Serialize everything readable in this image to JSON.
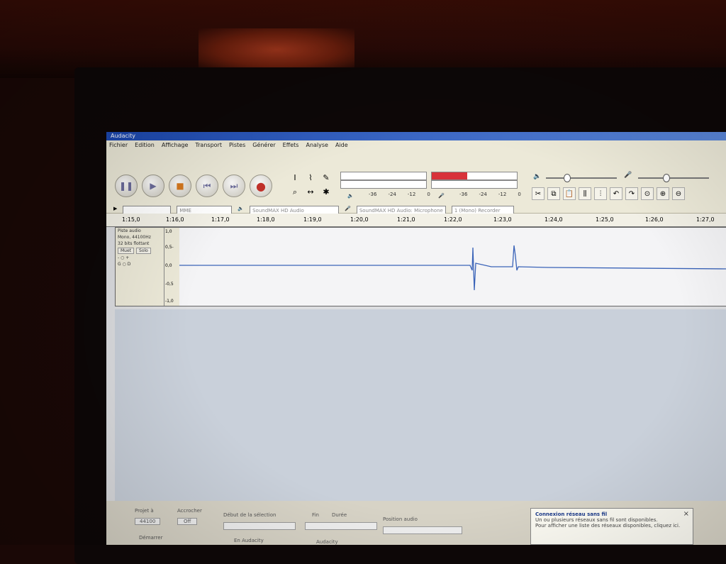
{
  "window": {
    "title": "Audacity"
  },
  "menu": [
    "Fichier",
    "Edition",
    "Affichage",
    "Transport",
    "Pistes",
    "Générer",
    "Effets",
    "Analyse",
    "Aide"
  ],
  "meters": {
    "left_channel_letters": [
      "G",
      "D"
    ],
    "ticks": [
      "-36",
      "-24",
      "-12",
      "0"
    ],
    "ticks_right": [
      "-36",
      "-24",
      "-12",
      "0"
    ]
  },
  "devices": {
    "host": "MME",
    "output": "SoundMAX HD Audio",
    "input": "SoundMAX HD Audio: Microphone",
    "channels": "1 (Mono) Recorder"
  },
  "ruler": [
    "1:15,0",
    "1:16,0",
    "1:17,0",
    "1:18,0",
    "1:19,0",
    "1:20,0",
    "1:21,0",
    "1:22,0",
    "1:23,0",
    "1:24,0",
    "1:25,0",
    "1:26,0",
    "1:27,0"
  ],
  "track": {
    "name": "Piste audio",
    "info1": "Mono, 44100Hz",
    "info2": "32 bits flottant",
    "mute": "Muet",
    "solo": "Solo",
    "yaxis": [
      "1,0",
      "0,5-",
      "0,0",
      "-0,5",
      "-1,0"
    ]
  },
  "status": {
    "rate_label": "Projet à",
    "rate_value": "44100",
    "snap_label": "Accrocher",
    "snap_value": "Off",
    "sel_label": "Début de la sélection",
    "end_label": "Fin",
    "len_label": "Durée",
    "pos_label": "Position audio",
    "bottom_left": "Démarrer",
    "bottom_center": "En Audacity",
    "bottom_right": "Audacity"
  },
  "notification": {
    "title": "Connexion réseau sans fil",
    "line1": "Un ou plusieurs réseaux sans fil sont disponibles.",
    "line2": "Pour afficher une liste des réseaux disponibles, cliquez ici."
  },
  "colors": {
    "waveform": "#3a63b8",
    "meter_red": "#d8323a",
    "titlebar": "#1c48b0"
  }
}
